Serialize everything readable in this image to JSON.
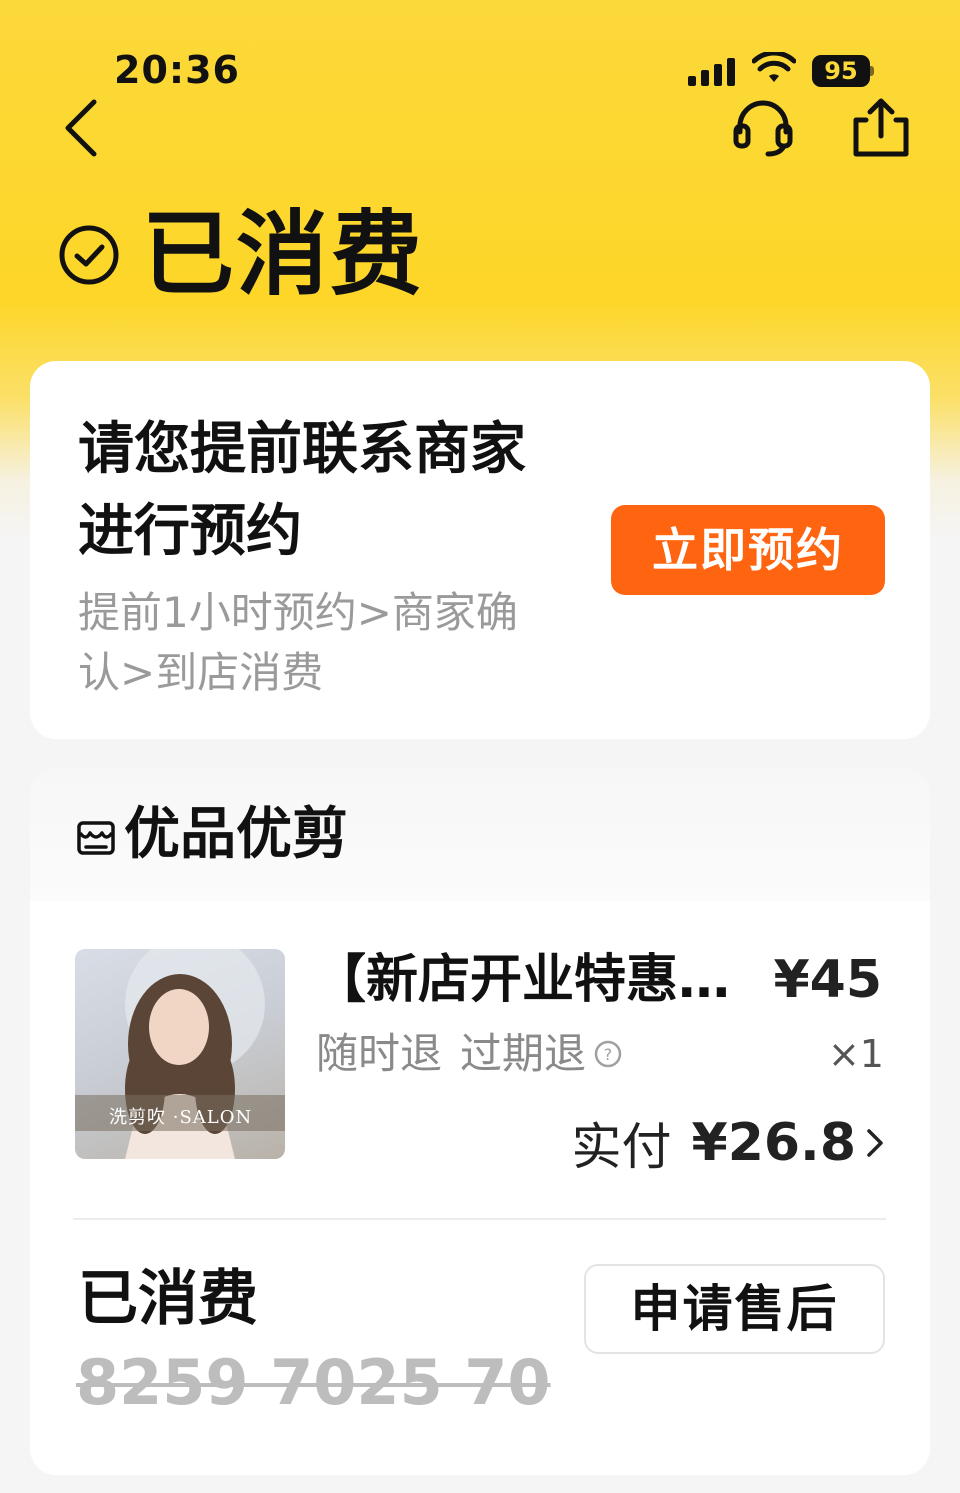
{
  "status_bar": {
    "time": "20:36",
    "battery": "95"
  },
  "header": {
    "back_icon": "chevron-left-icon",
    "service_icon": "headset-icon",
    "share_icon": "share-icon"
  },
  "order_status": {
    "icon": "check-circle-icon",
    "title": "已消费"
  },
  "booking_card": {
    "headline": "请您提前联系商家进行预约",
    "subtitle": "提前1小时预约>商家确认>到店消费",
    "button_label": "立即预约",
    "button_color": "#ff6410"
  },
  "store": {
    "icon": "storefront-icon",
    "name": "优品优剪"
  },
  "product": {
    "thumbnail_text": "洗剪吹 ·SALON",
    "title": "【新店开业特惠…",
    "price": "¥45",
    "refund_policy_1": "随时退",
    "refund_policy_2": "过期退",
    "help_icon": "question-circle-icon",
    "quantity": "×1",
    "paid_label": "实付",
    "paid_value": "¥26.8"
  },
  "voucher": {
    "status": "已消费",
    "code": "8259 7025 70",
    "after_sale_label": "申请售后"
  },
  "colors": {
    "header_yellow": "#fcd93a",
    "accent_orange": "#ff6410",
    "muted_text": "#9a9a9a"
  }
}
